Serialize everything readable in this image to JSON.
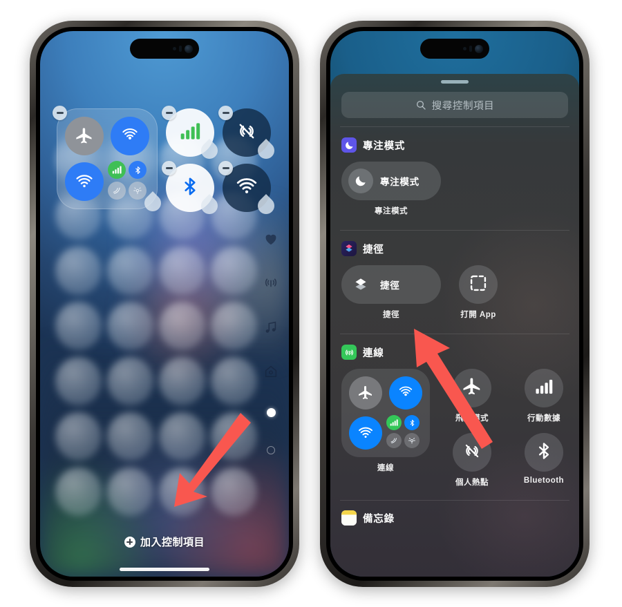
{
  "meta": {
    "accent_red": "#f9574f",
    "ios_blue": "#0a84ff",
    "ios_green": "#34c759",
    "focus_purple": "#5e55e8"
  },
  "left_phone": {
    "name": "control-center-edit-mode",
    "status_island": "dynamic-island",
    "edit_tiles": [
      {
        "name": "connectivity-group",
        "kind": "group",
        "icons": [
          "airplane-icon",
          "airdrop-icon",
          "wifi-icon",
          "cellular-icon",
          "bluetooth-icon",
          "satellite-icon",
          "sos-icon"
        ],
        "badge": "minus",
        "handle": "resize-handle"
      },
      {
        "name": "cellular-data-tile",
        "kind": "round-light",
        "icon": "cellular-bars-icon",
        "badge": "minus",
        "handle": "resize-handle"
      },
      {
        "name": "personal-hotspot-tile",
        "kind": "round-dark",
        "icon": "hotspot-off-icon",
        "badge": "minus",
        "handle": "resize-handle"
      },
      {
        "name": "bluetooth-tile",
        "kind": "round-light",
        "icon": "bluetooth-icon",
        "badge": "minus",
        "handle": "resize-handle"
      },
      {
        "name": "wifi-tile",
        "kind": "round-dark",
        "icon": "wifi-icon",
        "badge": "minus",
        "handle": "resize-handle"
      }
    ],
    "rail_icons": [
      "heart-icon",
      "connectivity-icon",
      "music-note-icon",
      "home-icon"
    ],
    "page_dots": {
      "active_index": 0,
      "count": 2
    },
    "add_control": {
      "label": "加入控制項目",
      "icon": "plus-circle-icon"
    },
    "home_indicator": "home-indicator"
  },
  "right_phone": {
    "name": "add-control-sheet",
    "grabber": "sheet-grabber",
    "search": {
      "placeholder": "搜尋控制項目",
      "icon": "search-icon"
    },
    "sections": [
      {
        "name": "focus-section",
        "app_icon": "focus-moon-icon",
        "app_icon_color": "#5e55e8",
        "title": "專注模式",
        "controls": [
          {
            "name": "focus-control",
            "shape": "wide",
            "label": "專注模式",
            "caption": "專注模式",
            "icon": "moon-icon"
          }
        ]
      },
      {
        "name": "shortcuts-section",
        "app_icon": "shortcuts-icon",
        "app_icon_color": "#2a2050",
        "title": "捷徑",
        "controls": [
          {
            "name": "shortcut-control",
            "shape": "wide",
            "label": "捷徑",
            "caption": "捷徑",
            "icon": "shortcuts-layers-icon"
          },
          {
            "name": "open-app-control",
            "shape": "circle",
            "label": "",
            "caption": "打開 App",
            "icon": "dashed-square-icon"
          }
        ]
      },
      {
        "name": "connectivity-section",
        "app_icon": "connectivity-icon",
        "app_icon_color": "#34c759",
        "title": "連線",
        "controls": [
          {
            "name": "connectivity-group-control",
            "shape": "group",
            "caption": "連線",
            "icon": "connectivity-group-icon"
          },
          {
            "name": "airplane-mode-control",
            "shape": "circle",
            "caption": "飛航模式",
            "icon": "airplane-icon"
          },
          {
            "name": "cellular-data-control",
            "shape": "circle",
            "caption": "行動數據",
            "icon": "cellular-bars-icon"
          },
          {
            "name": "personal-hotspot-control",
            "shape": "circle",
            "caption": "個人熱點",
            "icon": "hotspot-off-icon"
          },
          {
            "name": "bluetooth-control",
            "shape": "circle",
            "caption": "Bluetooth",
            "icon": "bluetooth-icon"
          }
        ]
      },
      {
        "name": "notes-section",
        "app_icon": "notes-icon",
        "app_icon_color": "#f5d54a",
        "title": "備忘錄",
        "controls": []
      }
    ]
  },
  "annotations": [
    {
      "name": "arrow-to-add-control",
      "direction": "down-left",
      "color": "#f9574f"
    },
    {
      "name": "arrow-to-shortcut-control",
      "direction": "up-left",
      "color": "#f9574f"
    }
  ]
}
